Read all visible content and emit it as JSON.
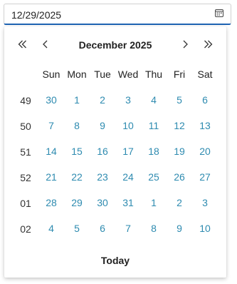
{
  "date_input": {
    "value": "12/29/2025",
    "calendar_icon": "calendar-icon"
  },
  "calendar": {
    "title": "December 2025",
    "nav_icons": {
      "prev_year": "double-chevron-left-icon",
      "prev_month": "chevron-left-icon",
      "next_month": "chevron-right-icon",
      "next_year": "double-chevron-right-icon"
    },
    "weekday_headers": [
      "Sun",
      "Mon",
      "Tue",
      "Wed",
      "Thu",
      "Fri",
      "Sat"
    ],
    "weeks": [
      {
        "week": "49",
        "days": [
          "30",
          "1",
          "2",
          "3",
          "4",
          "5",
          "6"
        ]
      },
      {
        "week": "50",
        "days": [
          "7",
          "8",
          "9",
          "10",
          "11",
          "12",
          "13"
        ]
      },
      {
        "week": "51",
        "days": [
          "14",
          "15",
          "16",
          "17",
          "18",
          "19",
          "20"
        ]
      },
      {
        "week": "52",
        "days": [
          "21",
          "22",
          "23",
          "24",
          "25",
          "26",
          "27"
        ]
      },
      {
        "week": "01",
        "days": [
          "28",
          "29",
          "30",
          "31",
          "1",
          "2",
          "3"
        ]
      },
      {
        "week": "02",
        "days": [
          "4",
          "5",
          "6",
          "7",
          "8",
          "9",
          "10"
        ]
      }
    ],
    "today_label": "Today"
  },
  "colors": {
    "accent_underline": "#1e63b3",
    "day_text": "#2e8bb0",
    "text": "#222222"
  }
}
